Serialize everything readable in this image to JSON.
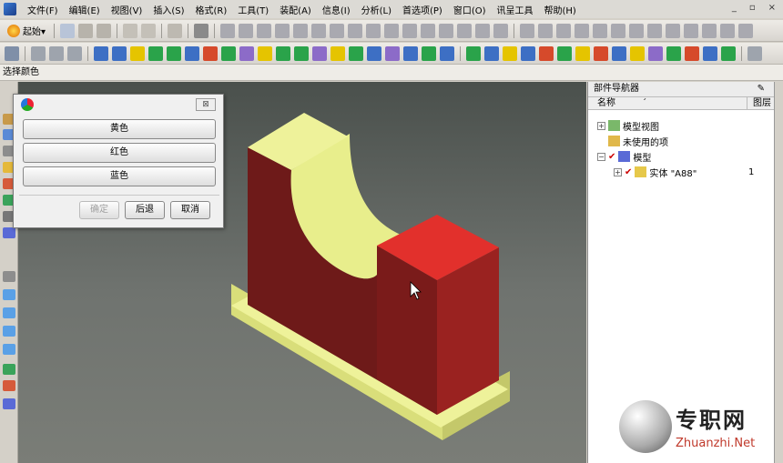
{
  "menu": {
    "items": [
      "文件(F)",
      "编辑(E)",
      "视图(V)",
      "插入(S)",
      "格式(R)",
      "工具(T)",
      "装配(A)",
      "信息(I)",
      "分析(L)",
      "首选项(P)",
      "窗口(O)",
      "讯呈工具",
      "帮助(H)"
    ],
    "window_controls": [
      "_",
      "▫",
      "×"
    ]
  },
  "toolbar": {
    "start_label": "起始▾"
  },
  "status": {
    "prompt": "选择颜色"
  },
  "dialog": {
    "buttons": [
      "黄色",
      "红色",
      "蓝色"
    ],
    "ok_label": "确定",
    "back_label": "后退",
    "cancel_label": "取消",
    "close_glyph": "⊠"
  },
  "navigator": {
    "title": "部件导航器",
    "pin_glyph": "✎",
    "columns": [
      "名称",
      "图层"
    ],
    "sort_glyph": "ˊ",
    "tree": [
      {
        "label": "模型视图",
        "expander": "+"
      },
      {
        "label": "未使用的项",
        "expander": ""
      },
      {
        "label": "模型",
        "expander": "−"
      },
      {
        "label": "实体 \"A88\"",
        "expander": "+",
        "layer": "1"
      }
    ]
  },
  "watermark": {
    "cn": "专职网",
    "en": "Zhuanzhi.Net"
  },
  "colors": {
    "model_red": "#7a1b1a",
    "model_bright_red": "#e2302c",
    "model_yellow": "#eef29a",
    "viewport_top": "#4a504c",
    "viewport_bottom": "#7a7d77"
  }
}
